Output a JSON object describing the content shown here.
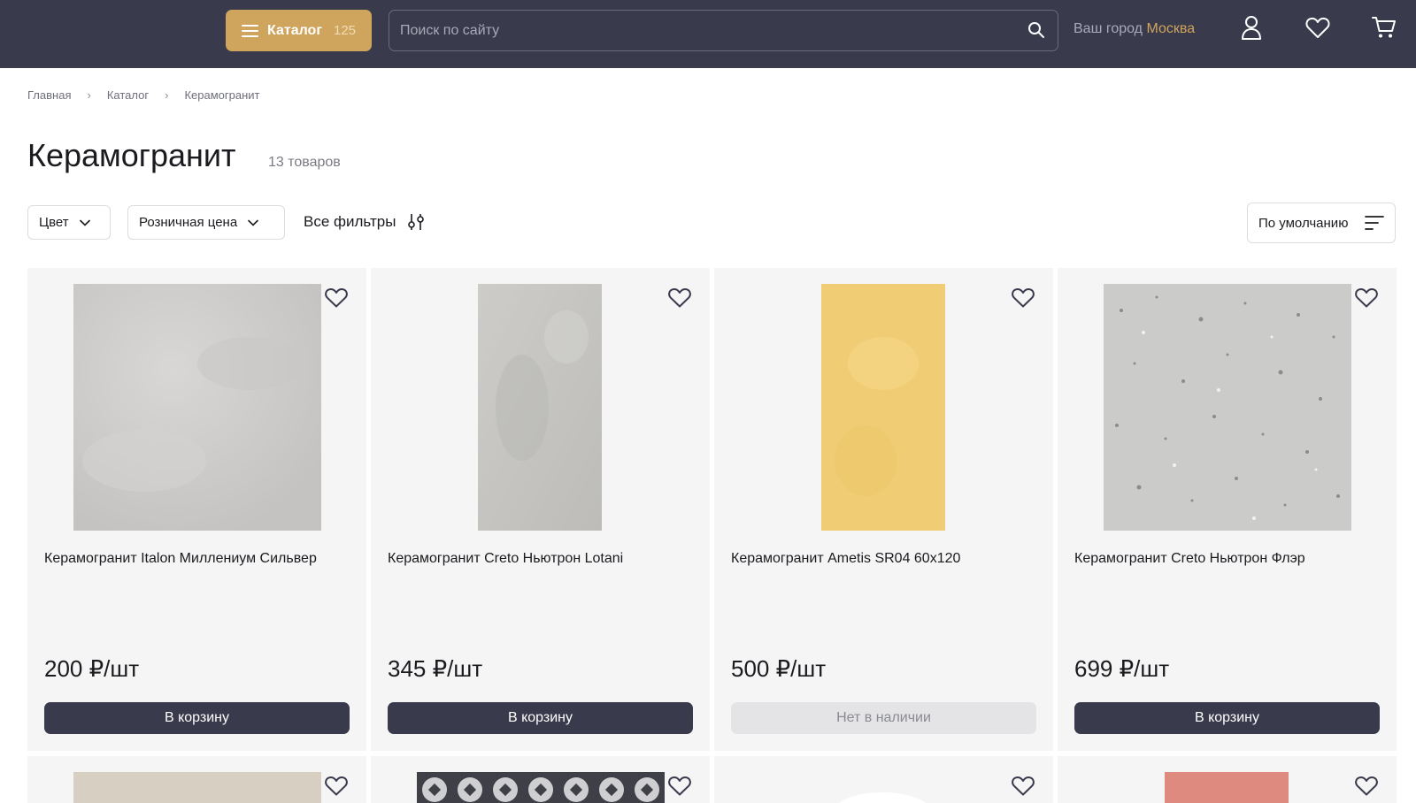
{
  "header": {
    "catalog_label": "Каталог",
    "catalog_count": "125",
    "search_placeholder": "Поиск по сайту",
    "city_label": "Ваш город",
    "city_name": "Москва",
    "icons": [
      "user-icon",
      "heart-icon",
      "cart-icon"
    ]
  },
  "breadcrumb": [
    "Главная",
    "Каталог",
    "Керамогранит"
  ],
  "page": {
    "title": "Керамогранит",
    "count": "13 товаров"
  },
  "filters": {
    "color": "Цвет",
    "price": "Розничная цена",
    "all": "Все фильтры",
    "sort": "По умолчанию"
  },
  "products": [
    {
      "title": "Керамогранит Italon Миллениум Сильвер",
      "price": "200 ₽/шт",
      "button": "В корзину",
      "available": true,
      "color": "#cfcecc"
    },
    {
      "title": "Керамогранит Creto Ньютрон Lotani",
      "price": "345 ₽/шт",
      "button": "В корзину",
      "available": true,
      "color": "#c6c5c2"
    },
    {
      "title": "Керамогранит Ametis SR04 60x120",
      "price": "500 ₽/шт",
      "button": "Нет в наличии",
      "available": false,
      "color": "#f0cd74"
    },
    {
      "title": "Керамогранит Creto Ньютрон Флэр",
      "price": "699 ₽/шт",
      "button": "В корзину",
      "available": true,
      "color": "#c9c9c7"
    }
  ],
  "colors": {
    "header_bg": "#393a4c",
    "accent": "#cfa45d",
    "card_bg": "#f5f5f6",
    "button_dark": "#393a4c"
  }
}
